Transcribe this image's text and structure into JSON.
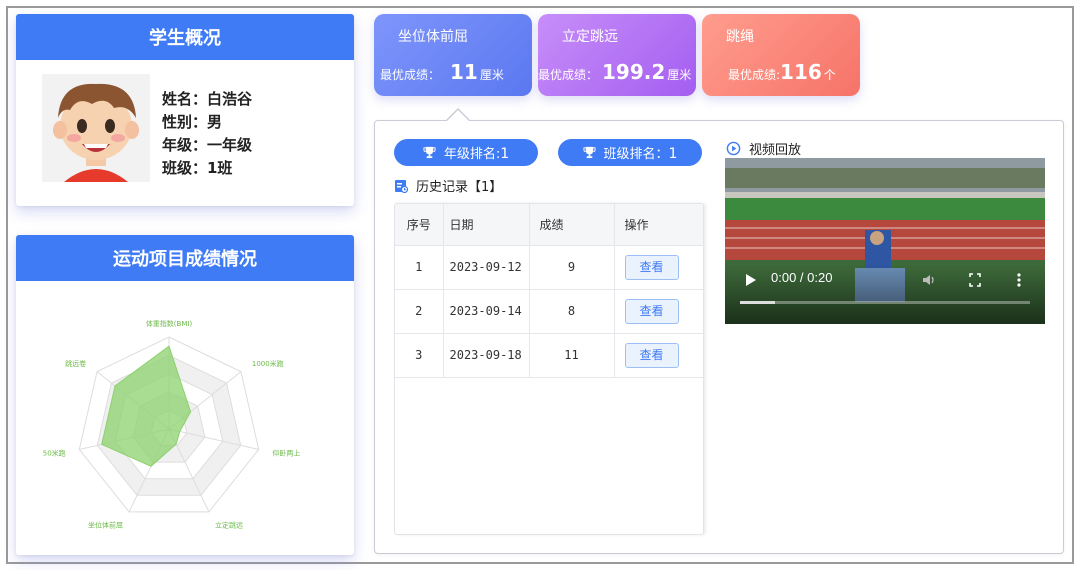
{
  "student": {
    "header": "学生概况",
    "name": "姓名：白浩谷",
    "gender": "性别：男",
    "grade": "年级：一年级",
    "class": "班级：1班"
  },
  "sports": {
    "header": "运动项目成绩情况"
  },
  "chart_data": {
    "type": "radar",
    "axes": [
      "体重指数(BMI)",
      "1000米跑",
      "仰卧两上",
      "立定跳远",
      "坐位体前屈",
      "50米跑",
      "跳远卷"
    ],
    "max": 100,
    "rings": 5,
    "series": [
      {
        "values": [
          90,
          30,
          12,
          18,
          45,
          75,
          75
        ],
        "color": "#8cd16e"
      }
    ]
  },
  "tabs": [
    {
      "title": "坐位体前屈",
      "score_label": "最优成绩：",
      "score": "11",
      "unit": "厘米",
      "color": "#6a85f5"
    },
    {
      "title": "立定跳远",
      "score_label": "最优成绩：",
      "score": "199.2",
      "unit": "厘米",
      "color": "#b474f4"
    },
    {
      "title": "跳绳",
      "score_label": "最优成绩:",
      "score": "116",
      "unit": "个",
      "color": "#fa8778"
    }
  ],
  "ranks": {
    "grade_label": "年级排名:",
    "grade_value": "1",
    "class_label": "班级排名：",
    "class_value": "1"
  },
  "history": {
    "label": "历史记录【1】"
  },
  "video": {
    "label": "视频回放",
    "time": "0:00 / 0:20",
    "progress": 0.12
  },
  "table": {
    "headers": [
      "序号",
      "日期",
      "成绩",
      "操作"
    ],
    "rows": [
      {
        "no": "1",
        "date": "2023-09-12",
        "score": "9",
        "action": "查看"
      },
      {
        "no": "2",
        "date": "2023-09-14",
        "score": "8",
        "action": "查看"
      },
      {
        "no": "3",
        "date": "2023-09-18",
        "score": "11",
        "action": "查看"
      }
    ]
  }
}
